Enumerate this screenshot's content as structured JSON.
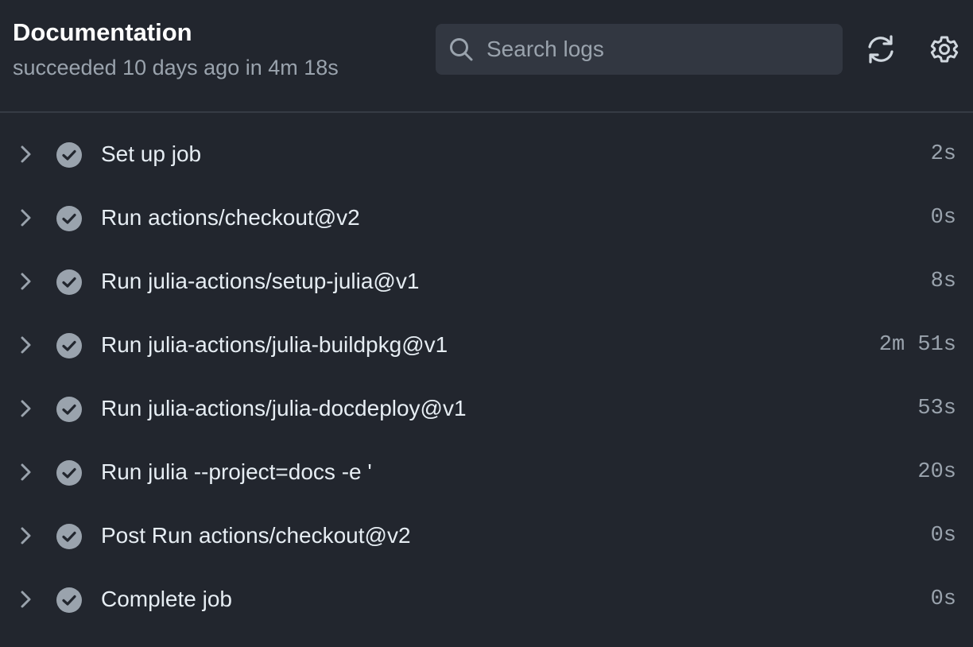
{
  "header": {
    "title": "Documentation",
    "subtitle": "succeeded 10 days ago in 4m 18s"
  },
  "search": {
    "placeholder": "Search logs",
    "value": "",
    "icon": "search-icon"
  },
  "toolbar": {
    "refresh_icon": "refresh-icon",
    "settings_icon": "gear-icon"
  },
  "colors": {
    "background": "#22262e",
    "search_background": "#323741",
    "check_circle": "#9aa3ad",
    "muted_text": "#9aa3ad",
    "text": "#e6edf3"
  },
  "steps": [
    {
      "name": "Set up job",
      "duration": "2s",
      "status": "success"
    },
    {
      "name": "Run actions/checkout@v2",
      "duration": "0s",
      "status": "success"
    },
    {
      "name": "Run julia-actions/setup-julia@v1",
      "duration": "8s",
      "status": "success"
    },
    {
      "name": "Run julia-actions/julia-buildpkg@v1",
      "duration": "2m 51s",
      "status": "success"
    },
    {
      "name": "Run julia-actions/julia-docdeploy@v1",
      "duration": "53s",
      "status": "success"
    },
    {
      "name": "Run julia --project=docs -e '",
      "duration": "20s",
      "status": "success"
    },
    {
      "name": "Post Run actions/checkout@v2",
      "duration": "0s",
      "status": "success"
    },
    {
      "name": "Complete job",
      "duration": "0s",
      "status": "success"
    }
  ]
}
